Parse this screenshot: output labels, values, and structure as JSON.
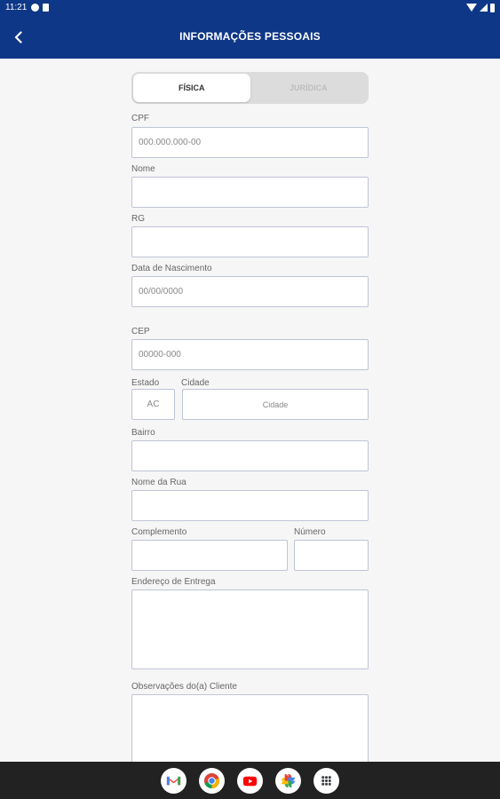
{
  "status_bar": {
    "time": "11:21"
  },
  "header": {
    "title": "INFORMAÇÕES PESSOAIS"
  },
  "person_type": {
    "options": [
      "FÍSICA",
      "JURÍDICA"
    ],
    "selected": "FÍSICA"
  },
  "form": {
    "cpf": {
      "label": "CPF",
      "placeholder": "000.000.000-00"
    },
    "nome": {
      "label": "Nome",
      "placeholder": ""
    },
    "rg": {
      "label": "RG",
      "placeholder": ""
    },
    "nascimento": {
      "label": "Data de Nascimento",
      "placeholder": "00/00/0000"
    },
    "cep": {
      "label": "CEP",
      "placeholder": "00000-000"
    },
    "estado": {
      "label": "Estado",
      "value": "AC"
    },
    "cidade": {
      "label": "Cidade",
      "placeholder": "Cidade"
    },
    "bairro": {
      "label": "Bairro",
      "placeholder": ""
    },
    "rua": {
      "label": "Nome da Rua",
      "placeholder": ""
    },
    "complemento": {
      "label": "Complemento",
      "placeholder": ""
    },
    "numero": {
      "label": "Número",
      "placeholder": ""
    },
    "entrega": {
      "label": "Endereço de Entrega",
      "placeholder": ""
    },
    "observacoes": {
      "label": "Observações do(a) Cliente",
      "placeholder": ""
    }
  },
  "dock": {
    "apps": [
      "gmail-icon",
      "chrome-icon",
      "youtube-icon",
      "photos-icon",
      "app-drawer-icon"
    ]
  },
  "colors": {
    "primary": "#0e3787",
    "background": "#f6f6f6",
    "field_border": "#bfc4d6"
  }
}
